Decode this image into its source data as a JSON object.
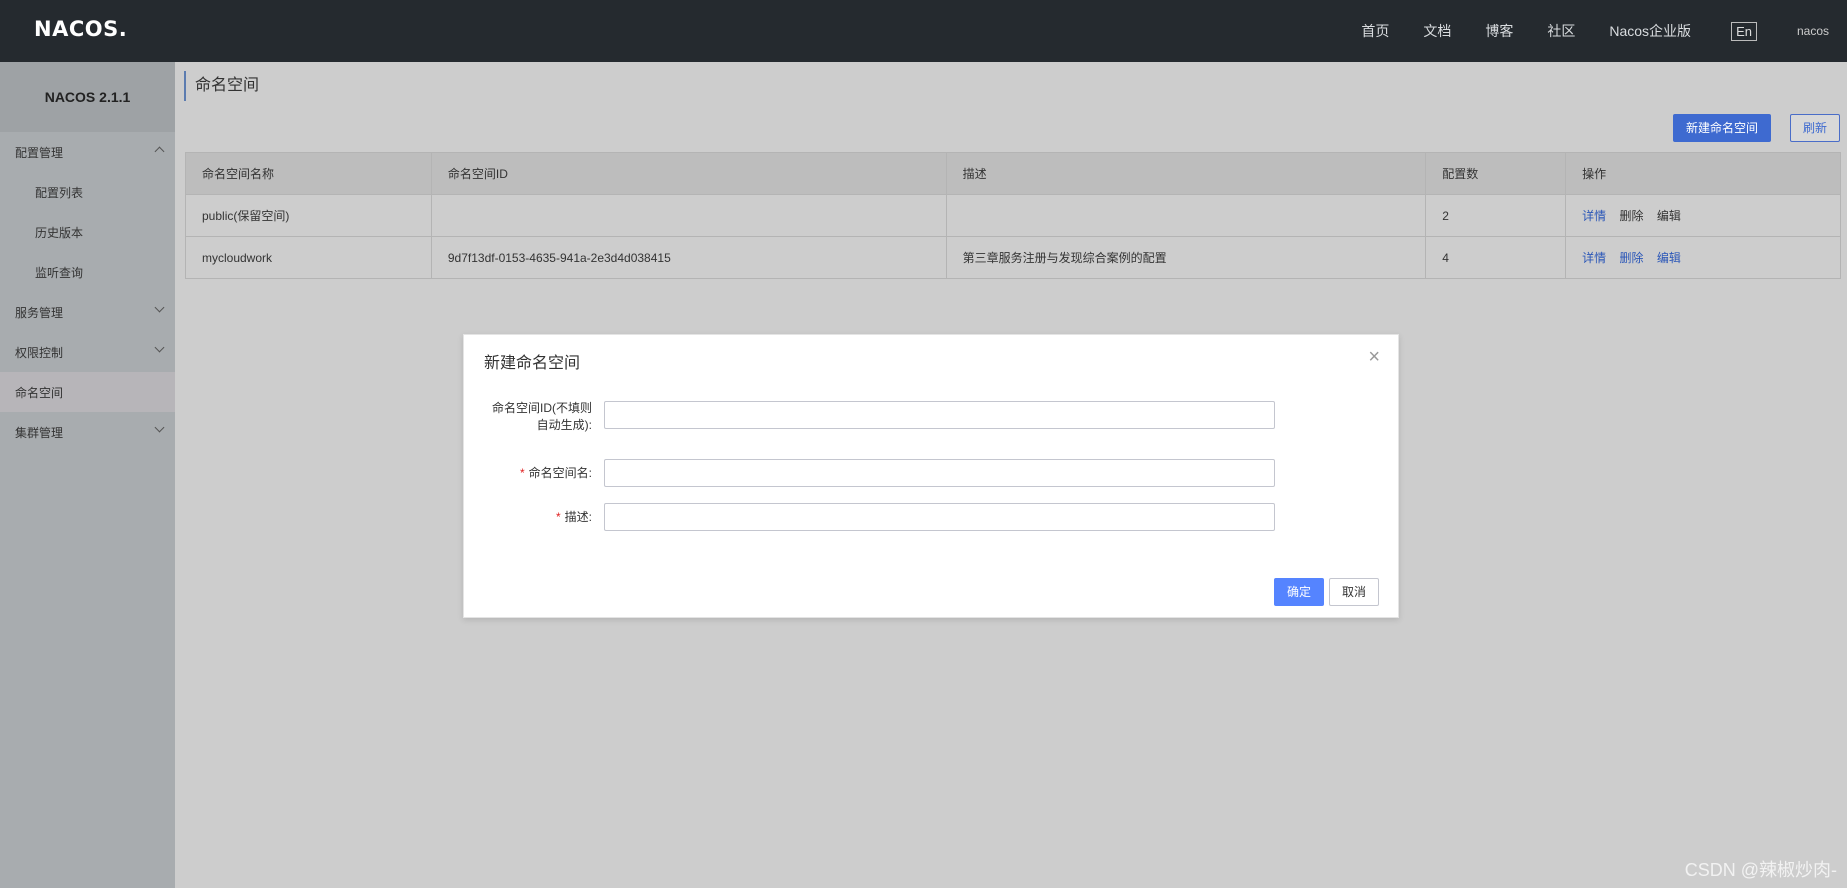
{
  "topbar": {
    "logo": "NACOS.",
    "nav": [
      "首页",
      "文档",
      "博客",
      "社区",
      "Nacos企业版"
    ],
    "lang": "En",
    "user": "nacos"
  },
  "sidebar": {
    "version": "NACOS 2.1.1",
    "items": [
      {
        "label": "配置管理",
        "level": 1,
        "expanded": true
      },
      {
        "label": "配置列表",
        "level": 2
      },
      {
        "label": "历史版本",
        "level": 2
      },
      {
        "label": "监听查询",
        "level": 2
      },
      {
        "label": "服务管理",
        "level": 1,
        "expanded": false
      },
      {
        "label": "权限控制",
        "level": 1,
        "expanded": false
      },
      {
        "label": "命名空间",
        "level": 1,
        "active": true
      },
      {
        "label": "集群管理",
        "level": 1,
        "expanded": false
      }
    ]
  },
  "main": {
    "title": "命名空间",
    "new_button": "新建命名空间",
    "refresh_button": "刷新",
    "table": {
      "columns": [
        "命名空间名称",
        "命名空间ID",
        "描述",
        "配置数",
        "操作"
      ],
      "rows": [
        {
          "name": "public(保留空间)",
          "id": "",
          "desc": "",
          "count": "2",
          "ops": [
            "详情",
            "删除",
            "编辑"
          ]
        },
        {
          "name": "mycloudwork",
          "id": "9d7f13df-0153-4635-941a-2e3d4d038415",
          "desc": "第三章服务注册与发现综合案例的配置",
          "count": "4",
          "ops": [
            "详情",
            "删除",
            "编辑"
          ]
        }
      ]
    }
  },
  "dialog": {
    "title": "新建命名空间",
    "close": "×",
    "fields": [
      {
        "label_line1": "命名空间ID(不填则",
        "label_line2": "自动生成):",
        "required": false,
        "value": ""
      },
      {
        "label": "命名空间名:",
        "required": true,
        "value": ""
      },
      {
        "label": "描述:",
        "required": true,
        "value": ""
      }
    ],
    "ok": "确定",
    "cancel": "取消"
  },
  "watermark": "CSDN @辣椒炒肉-",
  "colors": {
    "topbar_bg": "#252a2f",
    "primary": "#3e6ad0",
    "link": "#2b57b8",
    "required": "#e02020"
  }
}
